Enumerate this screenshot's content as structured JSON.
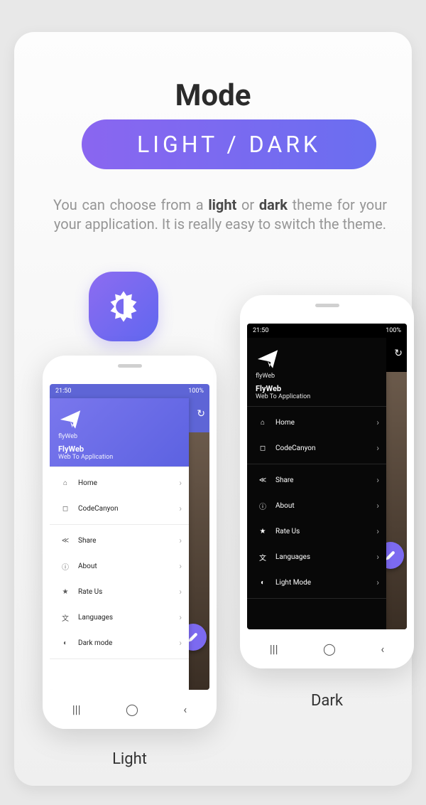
{
  "header": {
    "title": "Mode",
    "pill": "LIGHT / DARK"
  },
  "description": {
    "prefix": "You can choose from a ",
    "light": "light",
    "mid": " or ",
    "dark": "dark",
    "suffix": " theme for your your application. It is really easy to switch the theme."
  },
  "status": {
    "time": "21:50",
    "battery": "100%"
  },
  "app": {
    "logo_text": "flyWeb",
    "name": "FlyWeb",
    "subtitle": "Web To Application"
  },
  "menu": {
    "group1": [
      {
        "icon": "home-icon",
        "label": "Home"
      },
      {
        "icon": "cc-icon",
        "label": "CodeCanyon"
      }
    ],
    "group2_light": [
      {
        "icon": "share-icon",
        "label": "Share"
      },
      {
        "icon": "info-icon",
        "label": "About"
      },
      {
        "icon": "star-icon",
        "label": "Rate Us"
      },
      {
        "icon": "lang-icon",
        "label": "Languages"
      },
      {
        "icon": "theme-icon",
        "label": "Dark mode"
      }
    ],
    "group2_dark": [
      {
        "icon": "share-icon",
        "label": "Share"
      },
      {
        "icon": "info-icon",
        "label": "About"
      },
      {
        "icon": "star-icon",
        "label": "Rate Us"
      },
      {
        "icon": "lang-icon",
        "label": "Languages"
      },
      {
        "icon": "theme-icon",
        "label": "Light Mode"
      }
    ]
  },
  "captions": {
    "light": "Light",
    "dark": "Dark"
  }
}
